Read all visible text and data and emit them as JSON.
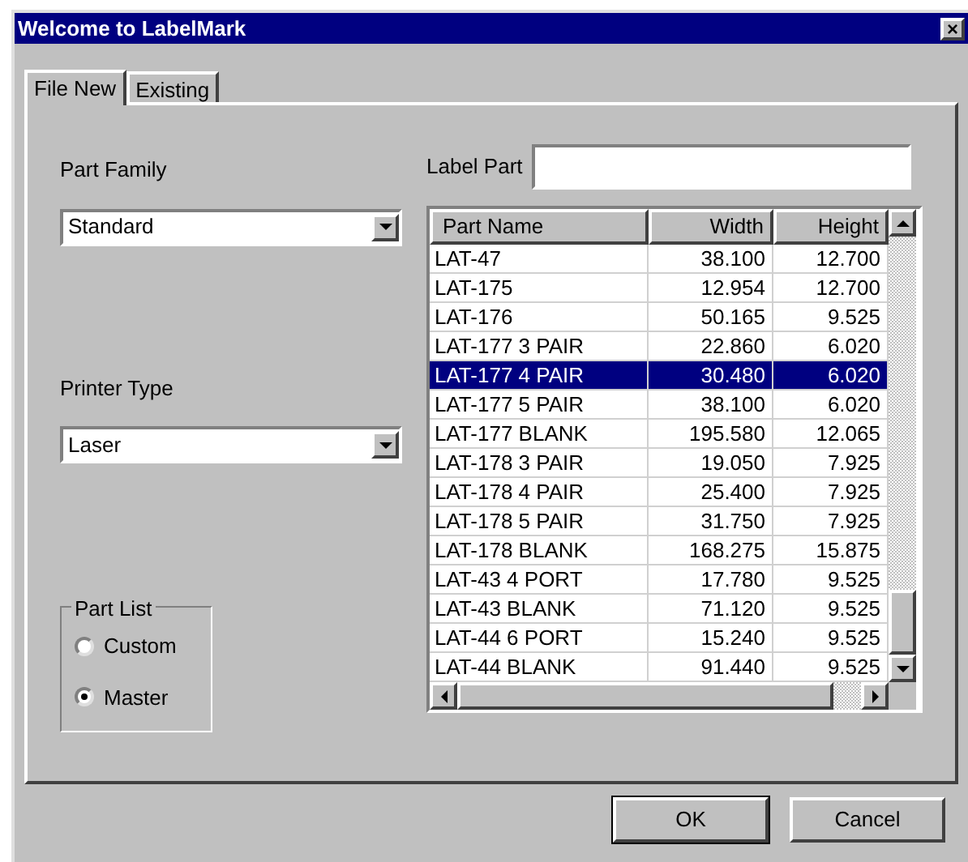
{
  "window": {
    "title": "Welcome to LabelMark",
    "close": "×"
  },
  "tabs": [
    {
      "label": "File New",
      "selected": true
    },
    {
      "label": "Existing",
      "selected": false
    }
  ],
  "part_family": {
    "label": "Part Family",
    "value": "Standard"
  },
  "printer_type": {
    "label": "Printer Type",
    "value": "Laser"
  },
  "part_list": {
    "label": "Part List",
    "options": [
      {
        "label": "Custom",
        "selected": false
      },
      {
        "label": "Master",
        "selected": true
      }
    ]
  },
  "label_part": {
    "label": "Label Part"
  },
  "table": {
    "columns": [
      "Part Name",
      "Width",
      "Height"
    ],
    "rows": [
      {
        "cells": [
          "LAT-47",
          "38.100",
          "12.700"
        ],
        "selected": false
      },
      {
        "cells": [
          "LAT-175",
          "12.954",
          "12.700"
        ],
        "selected": false
      },
      {
        "cells": [
          "LAT-176",
          "50.165",
          "9.525"
        ],
        "selected": false
      },
      {
        "cells": [
          "LAT-177 3 PAIR",
          "22.860",
          "6.020"
        ],
        "selected": false
      },
      {
        "cells": [
          "LAT-177 4 PAIR",
          "30.480",
          "6.020"
        ],
        "selected": true
      },
      {
        "cells": [
          "LAT-177 5 PAIR",
          "38.100",
          "6.020"
        ],
        "selected": false
      },
      {
        "cells": [
          "LAT-177 BLANK",
          "195.580",
          "12.065"
        ],
        "selected": false
      },
      {
        "cells": [
          "LAT-178 3 PAIR",
          "19.050",
          "7.925"
        ],
        "selected": false
      },
      {
        "cells": [
          "LAT-178 4 PAIR",
          "25.400",
          "7.925"
        ],
        "selected": false
      },
      {
        "cells": [
          "LAT-178 5 PAIR",
          "31.750",
          "7.925"
        ],
        "selected": false
      },
      {
        "cells": [
          "LAT-178 BLANK",
          "168.275",
          "15.875"
        ],
        "selected": false
      },
      {
        "cells": [
          "LAT-43 4 PORT",
          "17.780",
          "9.525"
        ],
        "selected": false
      },
      {
        "cells": [
          "LAT-43 BLANK",
          "71.120",
          "9.525"
        ],
        "selected": false
      },
      {
        "cells": [
          "LAT-44 6 PORT",
          "15.240",
          "9.525"
        ],
        "selected": false
      },
      {
        "cells": [
          "LAT-44 BLANK",
          "91.440",
          "9.525"
        ],
        "selected": false
      }
    ]
  },
  "buttons": [
    "OK",
    "Cancel"
  ]
}
